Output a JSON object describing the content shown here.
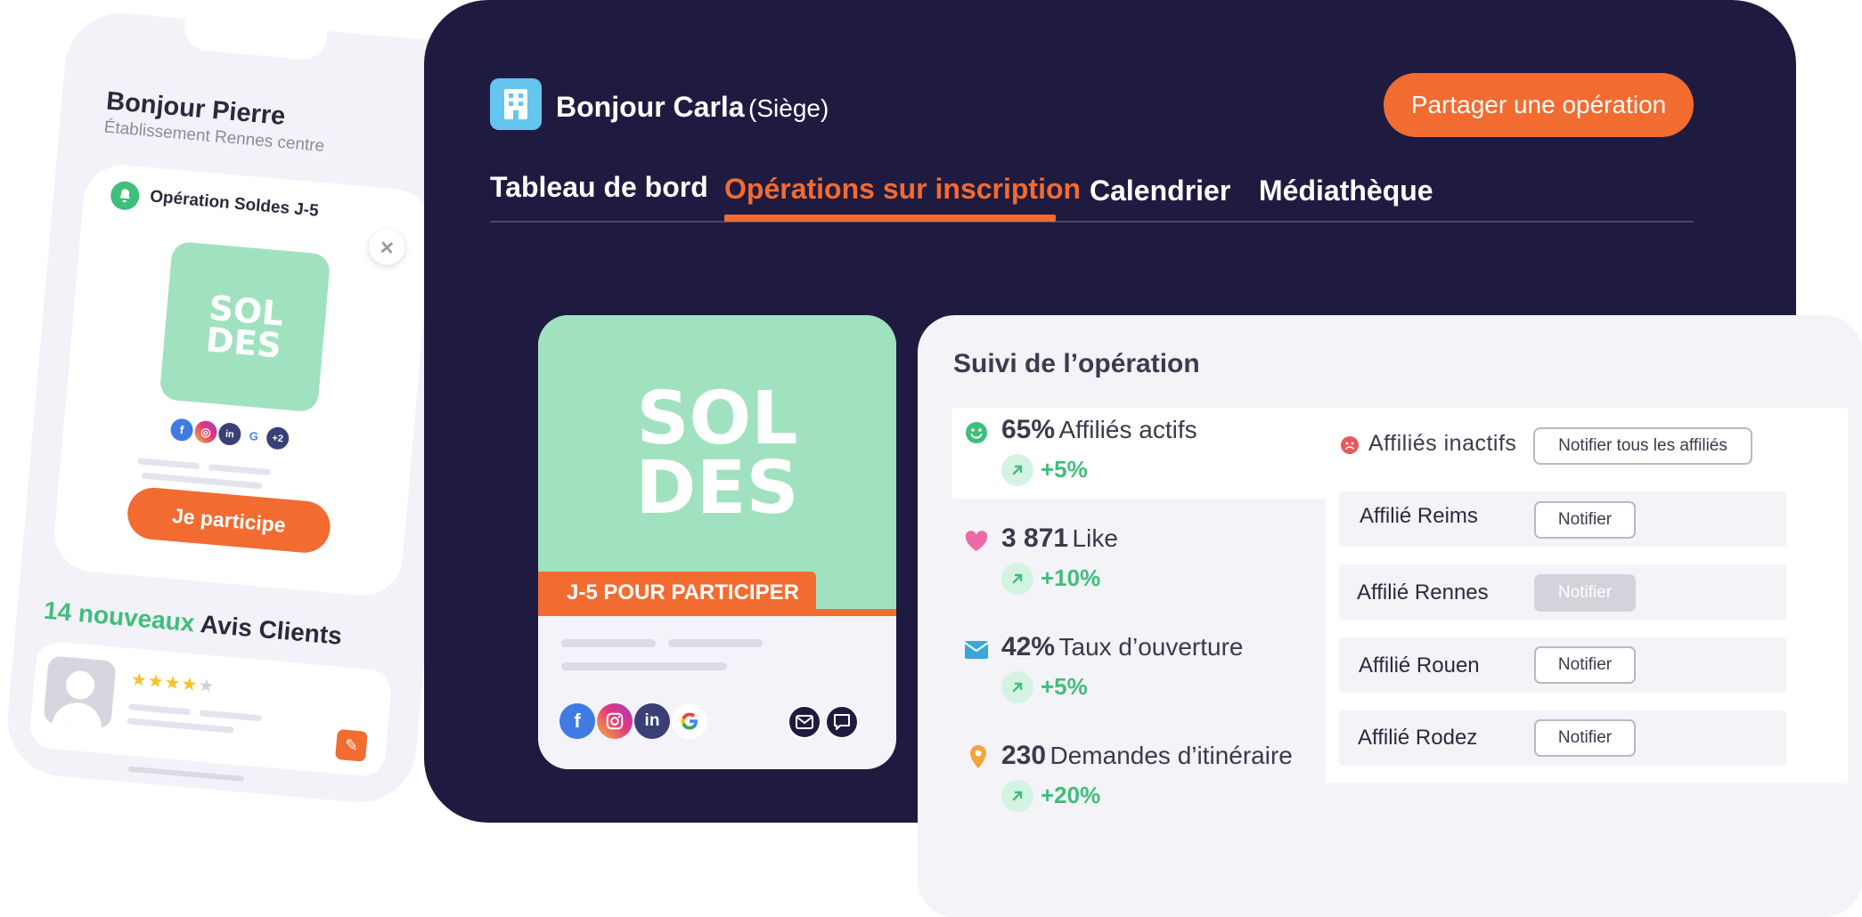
{
  "phone": {
    "greeting": "Bonjour Pierre",
    "establishment": "Établissement Rennes centre",
    "operation_title": "Opération Soldes J-5",
    "soldes_line1": "SOL",
    "soldes_line2": "DES",
    "extra_networks": "+2",
    "participate_button": "Je participe",
    "reviews_highlight": "14 nouveaux",
    "reviews_label": "Avis Clients",
    "stars_filled": 4,
    "stars_total": 5
  },
  "header": {
    "greeting": "Bonjour Carla",
    "role": "(Siège)",
    "share_button": "Partager une opération"
  },
  "tabs": [
    {
      "label": "Tableau de bord",
      "active": false
    },
    {
      "label": "Opérations sur inscription",
      "active": true
    },
    {
      "label": "Calendrier",
      "active": false
    },
    {
      "label": "Médiathèque",
      "active": false
    }
  ],
  "card": {
    "soldes_line1": "SOL",
    "soldes_line2": "DES",
    "ribbon": "J-5 POUR PARTICIPER"
  },
  "suivi": {
    "title": "Suivi de l’opération",
    "stats": [
      {
        "icon": "smile-icon",
        "value": "65%",
        "label": "Affiliés actifs",
        "trend": "+5%"
      },
      {
        "icon": "heart-icon",
        "value": "3 871",
        "label": "Like",
        "trend": "+10%"
      },
      {
        "icon": "mail-icon",
        "value": "42%",
        "label": "Taux d’ouverture",
        "trend": "+5%"
      },
      {
        "icon": "location-pin-icon",
        "value": "230",
        "label": "Demandes d’itinéraire",
        "trend": "+20%"
      }
    ],
    "inactive_label": "Affiliés inactifs",
    "notify_all_button": "Notifier tous les affiliés",
    "affiliates": [
      {
        "name": "Affilié Reims",
        "button": "Notifier",
        "disabled": false
      },
      {
        "name": "Affilié Rennes",
        "button": "Notifier",
        "disabled": true
      },
      {
        "name": "Affilié Rouen",
        "button": "Notifier",
        "disabled": false
      },
      {
        "name": "Affilié Rodez",
        "button": "Notifier",
        "disabled": false
      }
    ]
  },
  "colors": {
    "navy": "#1f1b40",
    "orange": "#f26b30",
    "mint": "#a0e2bf",
    "green": "#3fbf7a",
    "light_blue": "#64c5ee",
    "panel_gray": "#f3f3f8"
  }
}
